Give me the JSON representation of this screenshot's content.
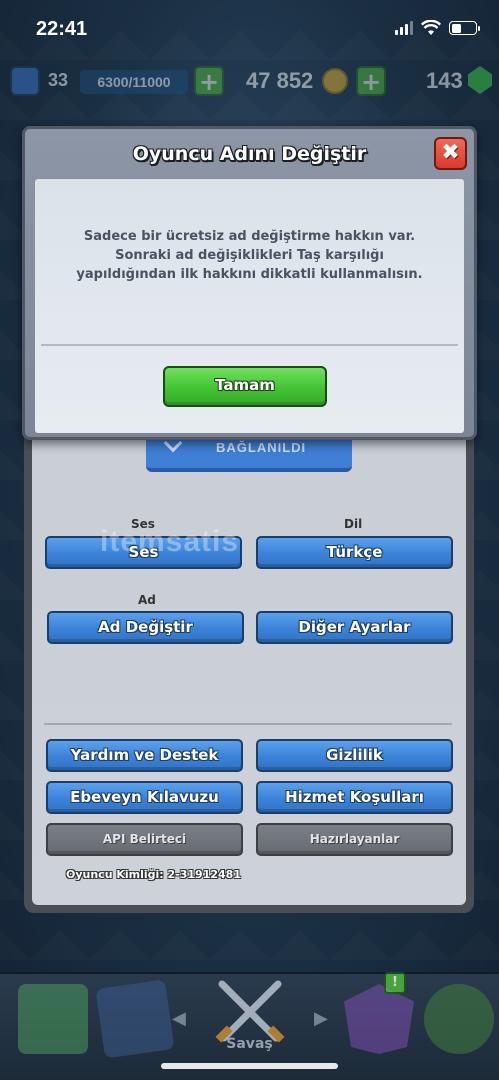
{
  "status_bar": {
    "time": "22:41"
  },
  "hud": {
    "level": "33",
    "xp": "6300/11000",
    "gold": "47 852",
    "gems": "143"
  },
  "dialog": {
    "title": "Oyuncu Adını Değiştir",
    "close_label": "✖",
    "message": "Sadece bir ücretsiz ad değiştirme hakkın var. Sonraki ad değişiklikleri Taş karşılığı yapıldığından ilk hakkını dikkatli kullanmalısın.",
    "ok_label": "Tamam"
  },
  "settings": {
    "linked_label": "BAĞLANILDI",
    "sound_section": "Ses",
    "language_section": "Dil",
    "name_section": "Ad",
    "sound_button": "Ses",
    "language_button": "Türkçe",
    "change_name_button": "Ad Değiştir",
    "other_settings_button": "Diğer Ayarlar",
    "help_button": "Yardım ve Destek",
    "privacy_button": "Gizlilik",
    "parent_guide_button": "Ebeveyn Kılavuzu",
    "terms_button": "Hizmet Koşulları",
    "api_token_button": "API Belirteci",
    "credits_button": "Hazırlayanlar",
    "player_id": "Oyuncu Kimliği: 2-31912481"
  },
  "watermark": "itemsatis",
  "bottom_nav": {
    "battle_label": "Savaş",
    "badge": "!"
  },
  "colors": {
    "blue_button": "#3b82d8",
    "green_button": "#42c334",
    "close_red": "#d9392a",
    "grey_button": "#666a71"
  }
}
